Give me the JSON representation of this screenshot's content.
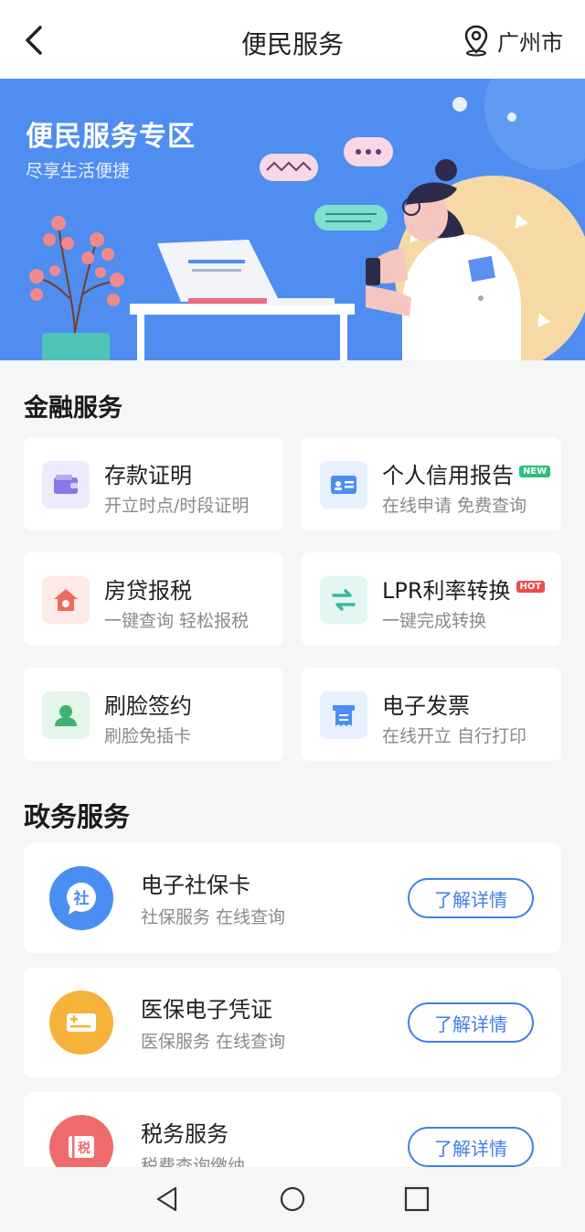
{
  "header": {
    "title": "便民服务",
    "location": "广州市"
  },
  "banner": {
    "title": "便民服务专区",
    "subtitle": "尽享生活便捷"
  },
  "finance": {
    "section_title": "金融服务",
    "items": [
      {
        "title": "存款证明",
        "subtitle": "开立时点/时段证明",
        "icon": "wallet-icon",
        "color": "#8a78e6"
      },
      {
        "title": "个人信用报告",
        "subtitle": "在线申请 免费查询",
        "icon": "id-card-icon",
        "color": "#4a8ef2",
        "badge": "NEW"
      },
      {
        "title": "房贷报税",
        "subtitle": "一键查询 轻松报税",
        "icon": "house-icon",
        "color": "#ee6a5e"
      },
      {
        "title": "LPR利率转换",
        "subtitle": "一键完成转换",
        "icon": "swap-icon",
        "color": "#34b8a0",
        "badge": "HOT"
      },
      {
        "title": "刷脸签约",
        "subtitle": "刷脸免插卡",
        "icon": "face-icon",
        "color": "#3fb372"
      },
      {
        "title": "电子发票",
        "subtitle": "在线开立 自行打印",
        "icon": "invoice-icon",
        "color": "#4a8ef2"
      }
    ]
  },
  "government": {
    "section_title": "政务服务",
    "items": [
      {
        "title": "电子社保卡",
        "subtitle": "社保服务 在线查询",
        "button": "了解详情",
        "icon_text": "社",
        "color": "#4a8ef2"
      },
      {
        "title": "医保电子凭证",
        "subtitle": "医保服务 在线查询",
        "button": "了解详情",
        "color": "#f6b23a"
      },
      {
        "title": "税务服务",
        "subtitle": "税费查询缴纳",
        "button": "了解详情",
        "icon_text": "税",
        "color": "#ef6b6b"
      }
    ]
  },
  "colors": {
    "banner": "#4f8ef0",
    "accent": "#3f7fe6",
    "badge_new": "#2cbf77",
    "badge_hot": "#ef4a4a"
  }
}
